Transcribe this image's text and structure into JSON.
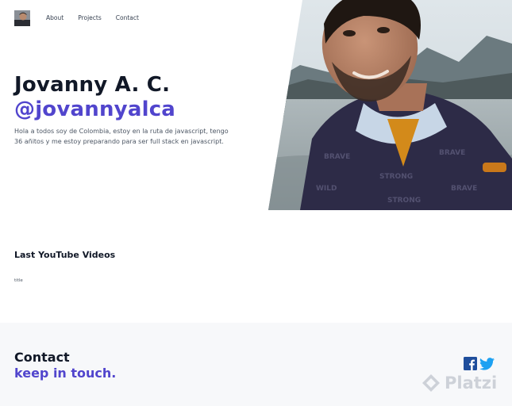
{
  "nav": {
    "links": [
      "About",
      "Projects",
      "Contact"
    ]
  },
  "hero": {
    "name": "Jovanny A. C.",
    "handle": "@jovannyalca",
    "bio": "Hola a todos soy de Colombia, estoy en la ruta de javascript, tengo 36 añitos y me estoy preparando para ser full stack en javascript."
  },
  "videos": {
    "title": "Last YouTube Videos",
    "items": [
      "title"
    ]
  },
  "footer": {
    "contact_title": "Contact",
    "contact_subtitle": "keep in touch."
  },
  "icons": {
    "facebook": "facebook-icon",
    "twitter": "twitter-icon",
    "watermark": "platzi-logo"
  },
  "watermark": {
    "text": "Platzi"
  },
  "colors": {
    "accent": "#5145cd",
    "heading": "#111827",
    "text": "#4b5563",
    "footer_bg": "#f7f8fa",
    "facebook": "#1f4e9c",
    "twitter": "#1da1f2"
  }
}
